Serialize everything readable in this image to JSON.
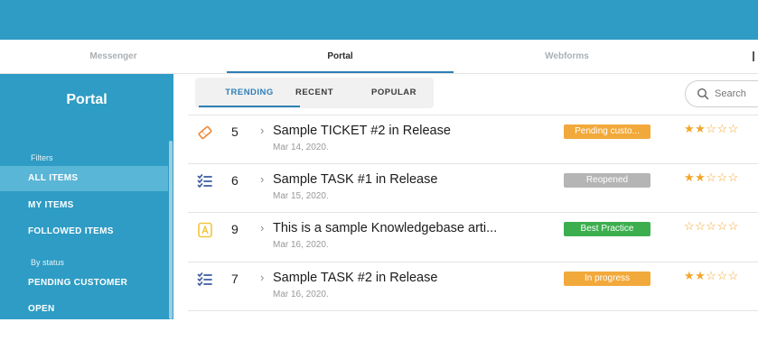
{
  "app_tabs": [
    {
      "label": "Messenger"
    },
    {
      "label": "Portal"
    },
    {
      "label": "Webforms"
    }
  ],
  "sidebar": {
    "title": "Portal",
    "filters_label": "Filters",
    "items": [
      {
        "label": "ALL ITEMS"
      },
      {
        "label": "MY ITEMS"
      },
      {
        "label": "FOLLOWED ITEMS"
      }
    ],
    "status_label": "By status",
    "status_items": [
      {
        "label": "PENDING CUSTOMER"
      },
      {
        "label": "OPEN"
      }
    ]
  },
  "view_tabs": [
    {
      "label": "TRENDING"
    },
    {
      "label": "RECENT"
    },
    {
      "label": "POPULAR"
    }
  ],
  "search": {
    "placeholder": "Search"
  },
  "rows": [
    {
      "icon": "ticket-icon",
      "number": "5",
      "title": "Sample TICKET #2 in Release",
      "date": "Mar 14, 2020.",
      "status": "Pending custo...",
      "status_color": "#f2a93b",
      "rating": 2
    },
    {
      "icon": "task-list-icon",
      "number": "6",
      "title": "Sample TASK #1 in Release",
      "date": "Mar 15, 2020.",
      "status": "Reopened",
      "status_color": "#b5b5b5",
      "rating": 2
    },
    {
      "icon": "article-icon",
      "number": "9",
      "title": "This is a sample Knowledgebase arti...",
      "date": "Mar 16, 2020.",
      "status": "Best Practice",
      "status_color": "#3cae4e",
      "rating": 0
    },
    {
      "icon": "task-list-icon",
      "number": "7",
      "title": "Sample TASK #2 in Release",
      "date": "Mar 16, 2020.",
      "status": "In progress",
      "status_color": "#f2a93b",
      "rating": 2
    }
  ],
  "colors": {
    "brand": "#2e9cc4",
    "accent": "#2e7fb6",
    "star": "#f2a62a"
  }
}
